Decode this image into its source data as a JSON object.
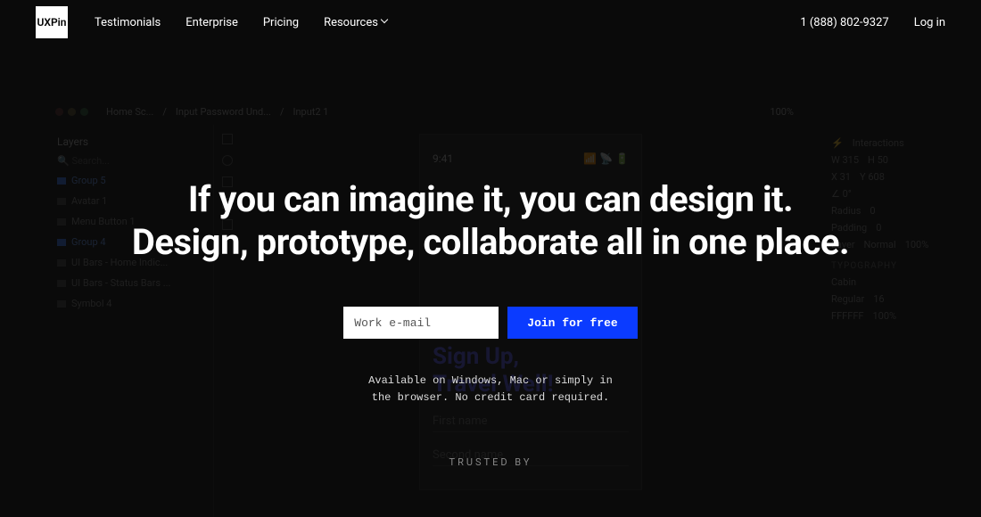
{
  "header": {
    "logo": "UXPin",
    "nav": [
      "Testimonials",
      "Enterprise",
      "Pricing",
      "Resources"
    ],
    "phone": "1 (888) 802-9327",
    "login": "Log in"
  },
  "hero": {
    "line1": "If you can imagine it, you can design it.",
    "line2": "Design, prototype, collaborate all in one place.",
    "email_placeholder": "Work e-mail",
    "cta": "Join for free",
    "subtext1": "Available on Windows, Mac or simply in",
    "subtext2": "the browser. No credit card required.",
    "trusted": "TRUSTED BY"
  },
  "editor": {
    "breadcrumb": [
      "Home Sc...",
      "Input Password Und...",
      "Input2 1"
    ],
    "zoom": "100%",
    "layers_title": "Layers",
    "search_placeholder": "Search...",
    "layers": [
      {
        "label": "Group 5",
        "sel": true
      },
      {
        "label": "Avatar 1",
        "sel": false
      },
      {
        "label": "Menu Button 1",
        "sel": false
      },
      {
        "label": "Group 4",
        "sel": true
      },
      {
        "label": "UI Bars - Home Indic...",
        "sel": false
      },
      {
        "label": "UI Bars - Status Bars ...",
        "sel": false
      },
      {
        "label": "Symbol 4",
        "sel": false
      }
    ],
    "right": {
      "interactions": "Interactions",
      "w": "315",
      "h": "50",
      "x": "31",
      "y": "608",
      "rotation": "0°",
      "radius_label": "Radius",
      "radius": "0",
      "padding_label": "Padding",
      "padding": "0",
      "layer_label": "Layer",
      "layer_mode": "Normal",
      "layer_opacity": "100%",
      "typography": "TYPOGRAPHY",
      "font_family": "Cabin",
      "font_weight": "Regular",
      "font_size": "16",
      "color": "FFFFFF",
      "color_opacity": "100%"
    },
    "phone": {
      "time": "9:41",
      "heading1": "Sign Up,",
      "heading2": "Travel Well!",
      "field1": "First name",
      "field2": "Second name"
    }
  }
}
